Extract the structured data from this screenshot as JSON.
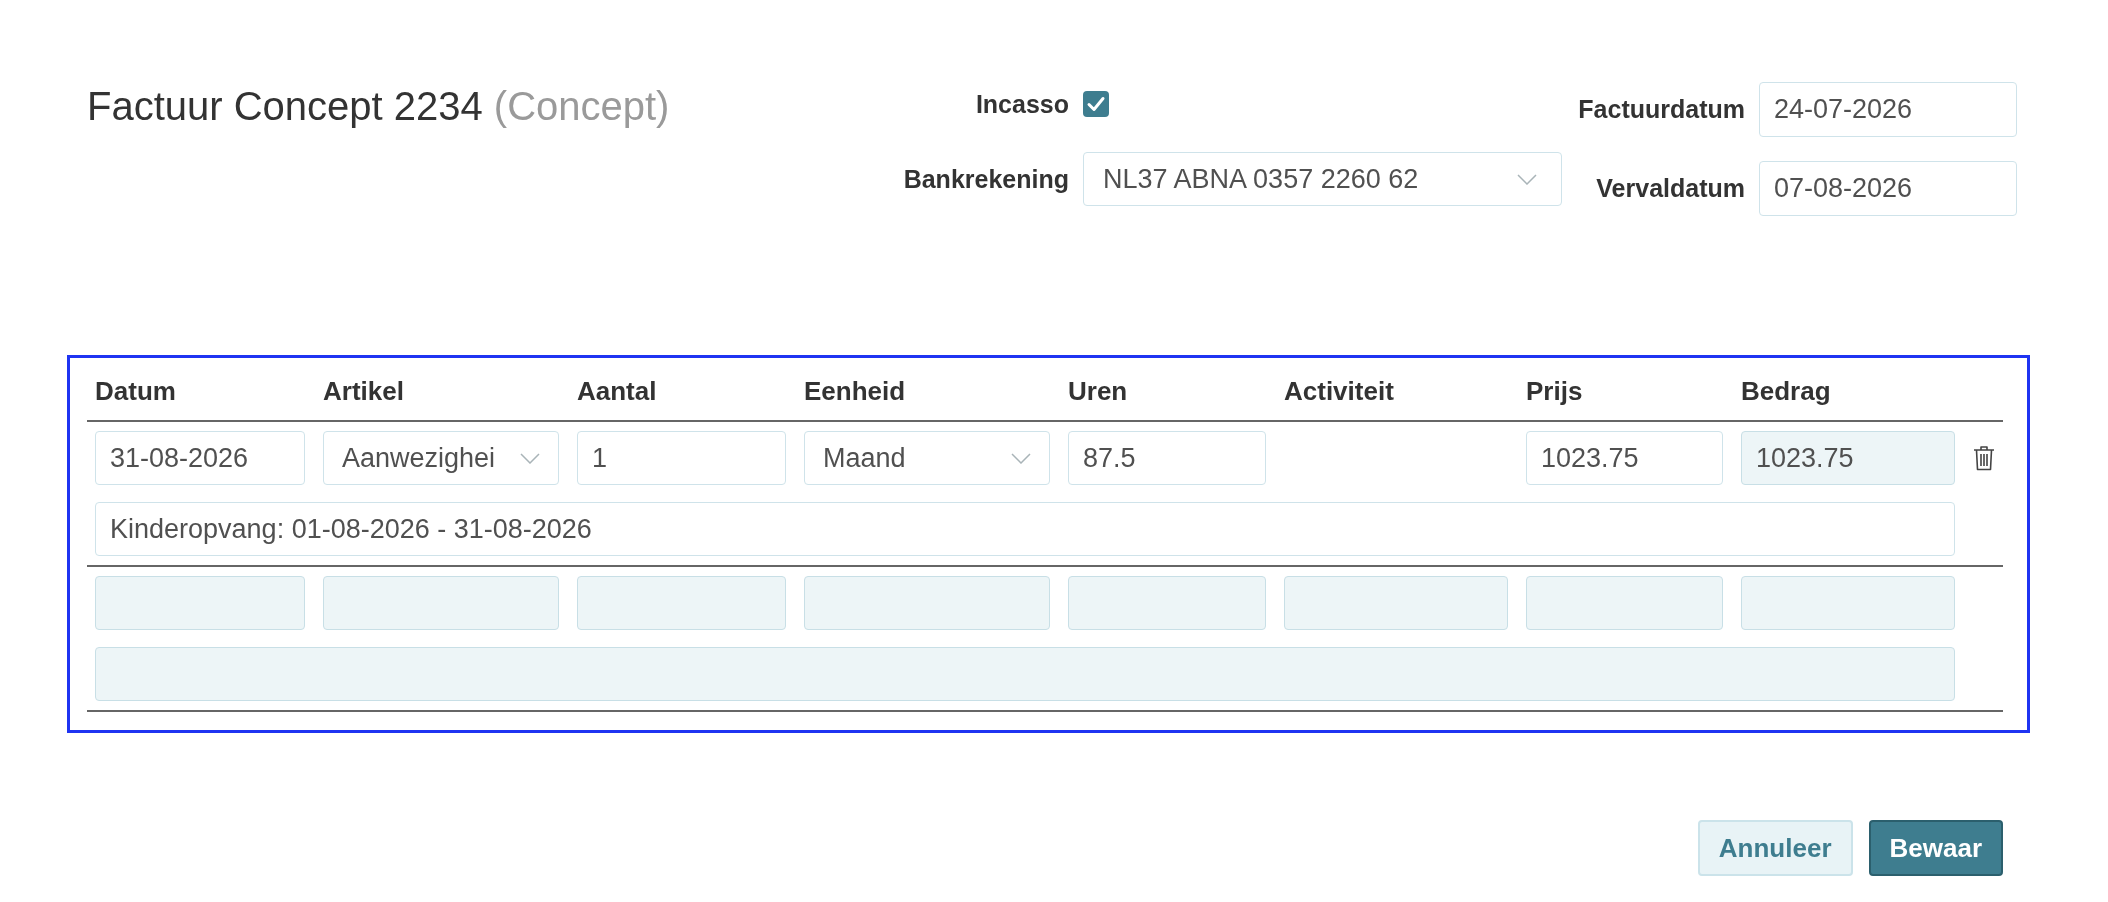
{
  "title": {
    "text": "Factuur Concept 2234",
    "status": "(Concept)"
  },
  "incasso": {
    "label": "Incasso",
    "checked": true
  },
  "bank_account": {
    "label": "Bankrekening",
    "value": "NL37 ABNA 0357 2260 62"
  },
  "invoice_date": {
    "label": "Factuurdatum",
    "value": "24-07-2026"
  },
  "due_date": {
    "label": "Vervaldatum",
    "value": "07-08-2026"
  },
  "table": {
    "columns": [
      "Datum",
      "Artikel",
      "Aantal",
      "Eenheid",
      "Uren",
      "Activiteit",
      "Prijs",
      "Bedrag"
    ],
    "rows": [
      {
        "cells": [
          {
            "kind": "input",
            "value": "31-08-2026",
            "disabled": false
          },
          {
            "kind": "select",
            "value": "Aanwezighei",
            "disabled": false
          },
          {
            "kind": "input",
            "value": "1",
            "disabled": false
          },
          {
            "kind": "select",
            "value": "Maand",
            "disabled": false
          },
          {
            "kind": "input",
            "value": "87.5",
            "disabled": false
          },
          {
            "kind": "blank"
          },
          {
            "kind": "input",
            "value": "1023.75",
            "disabled": false
          },
          {
            "kind": "input",
            "value": "1023.75",
            "disabled": true
          }
        ],
        "description": {
          "value": "Kinderopvang: 01-08-2026 - 31-08-2026",
          "disabled": false
        },
        "deletable": true
      },
      {
        "cells": [
          {
            "kind": "input",
            "disabled": true
          },
          {
            "kind": "input",
            "disabled": true
          },
          {
            "kind": "input",
            "disabled": true
          },
          {
            "kind": "input",
            "disabled": true
          },
          {
            "kind": "input",
            "disabled": true
          },
          {
            "kind": "input",
            "disabled": true
          },
          {
            "kind": "input",
            "disabled": true
          },
          {
            "kind": "input",
            "disabled": true
          }
        ],
        "description": {
          "disabled": true
        },
        "deletable": false
      }
    ]
  },
  "buttons": [
    {
      "label": "Annuleer",
      "kind": "secondary"
    },
    {
      "label": "Bewaar",
      "kind": "primary"
    }
  ]
}
